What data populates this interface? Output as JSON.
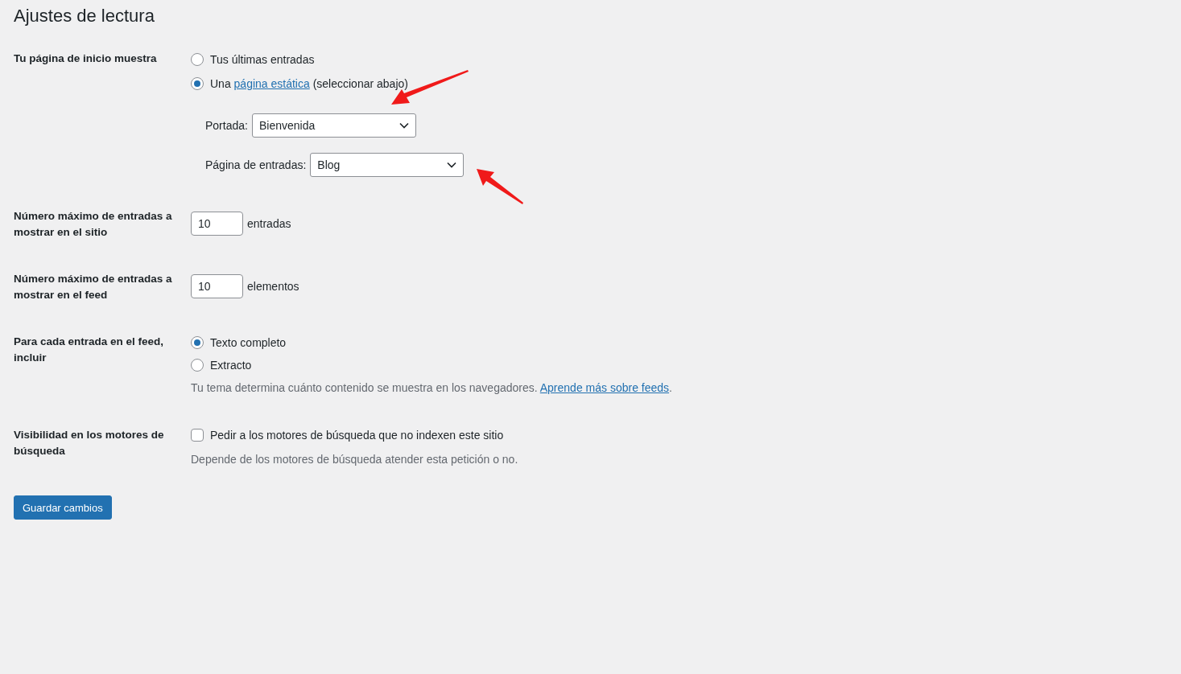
{
  "title": "Ajustes de lectura",
  "rows": [
    {
      "kind": "radio",
      "label": "Tu página de inicio muestra",
      "options": [
        {
          "text": "Tus últimas entradas",
          "selected": false
        },
        {
          "text": "Una",
          "link": "página estática",
          "after": "(seleccionar abajo)",
          "selected": true
        }
      ],
      "selects": [
        {
          "label": "Portada:",
          "value": "Bienvenida"
        },
        {
          "label": "Página de entradas:",
          "value": "Blog"
        }
      ]
    },
    {
      "kind": "number",
      "label": "Número máximo de entradas a mostrar en el sitio",
      "value": "10",
      "unit": "entradas"
    },
    {
      "kind": "number",
      "label": "Número máximo de entradas a mostrar en el feed",
      "value": "10",
      "unit": "elementos"
    },
    {
      "kind": "radio",
      "label": "Para cada entrada en el feed, incluir",
      "options": [
        {
          "text": "Texto completo",
          "selected": true
        },
        {
          "text": "Extracto",
          "selected": false
        }
      ],
      "description": {
        "text": "Tu tema determina cuánto contenido se muestra en los navegadores.",
        "link": "Aprende más sobre feeds",
        "after": "."
      }
    },
    {
      "kind": "checkbox",
      "label": "Visibilidad en los motores de búsqueda",
      "text": "Pedir a los motores de búsqueda que no indexen este sitio",
      "checked": false,
      "description": {
        "text": "Depende de los motores de búsqueda atender esta petición o no."
      }
    }
  ],
  "save_button": "Guardar cambios"
}
